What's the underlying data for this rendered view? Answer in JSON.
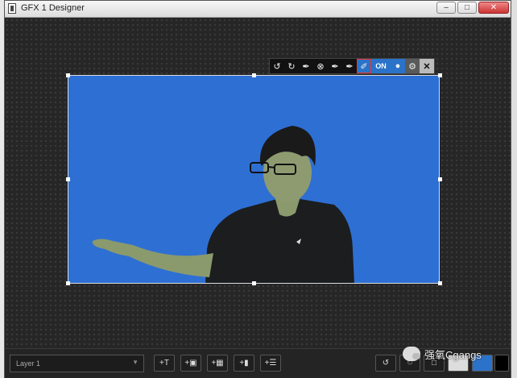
{
  "window": {
    "title": "GFX 1 Designer",
    "controls": [
      "minimize",
      "maximize",
      "close"
    ]
  },
  "toolbar": {
    "items": [
      "rotate-left-icon",
      "rotate-right-icon",
      "eyedropper-icon",
      "clear-icon",
      "eyedropper-minus-icon",
      "eyedropper-plus-icon",
      "keyer-pen-icon"
    ],
    "on_label": "ON",
    "keyer_color": "#2b72c9",
    "active_border": "#e33333"
  },
  "canvas": {
    "source_background": "#2e6fd3"
  },
  "bottom": {
    "layer": "Layer 1",
    "add_buttons": [
      "add-text-button",
      "add-image-button",
      "add-media-button",
      "add-video-button",
      "add-list-button"
    ],
    "undo_icon": "undo-icon",
    "redo_icon": "redo-icon"
  },
  "watermark": {
    "text": "强氧Cgangs"
  },
  "colors": {
    "colorbars": [
      "#e8e8e8",
      "#d8d0d8",
      "#ece41e",
      "#2a2fa0",
      "#b8c8c8",
      "#8fc94a",
      "#36b4c8",
      "#3fb34a",
      "#d14dc8",
      "#e0e0e0"
    ]
  }
}
